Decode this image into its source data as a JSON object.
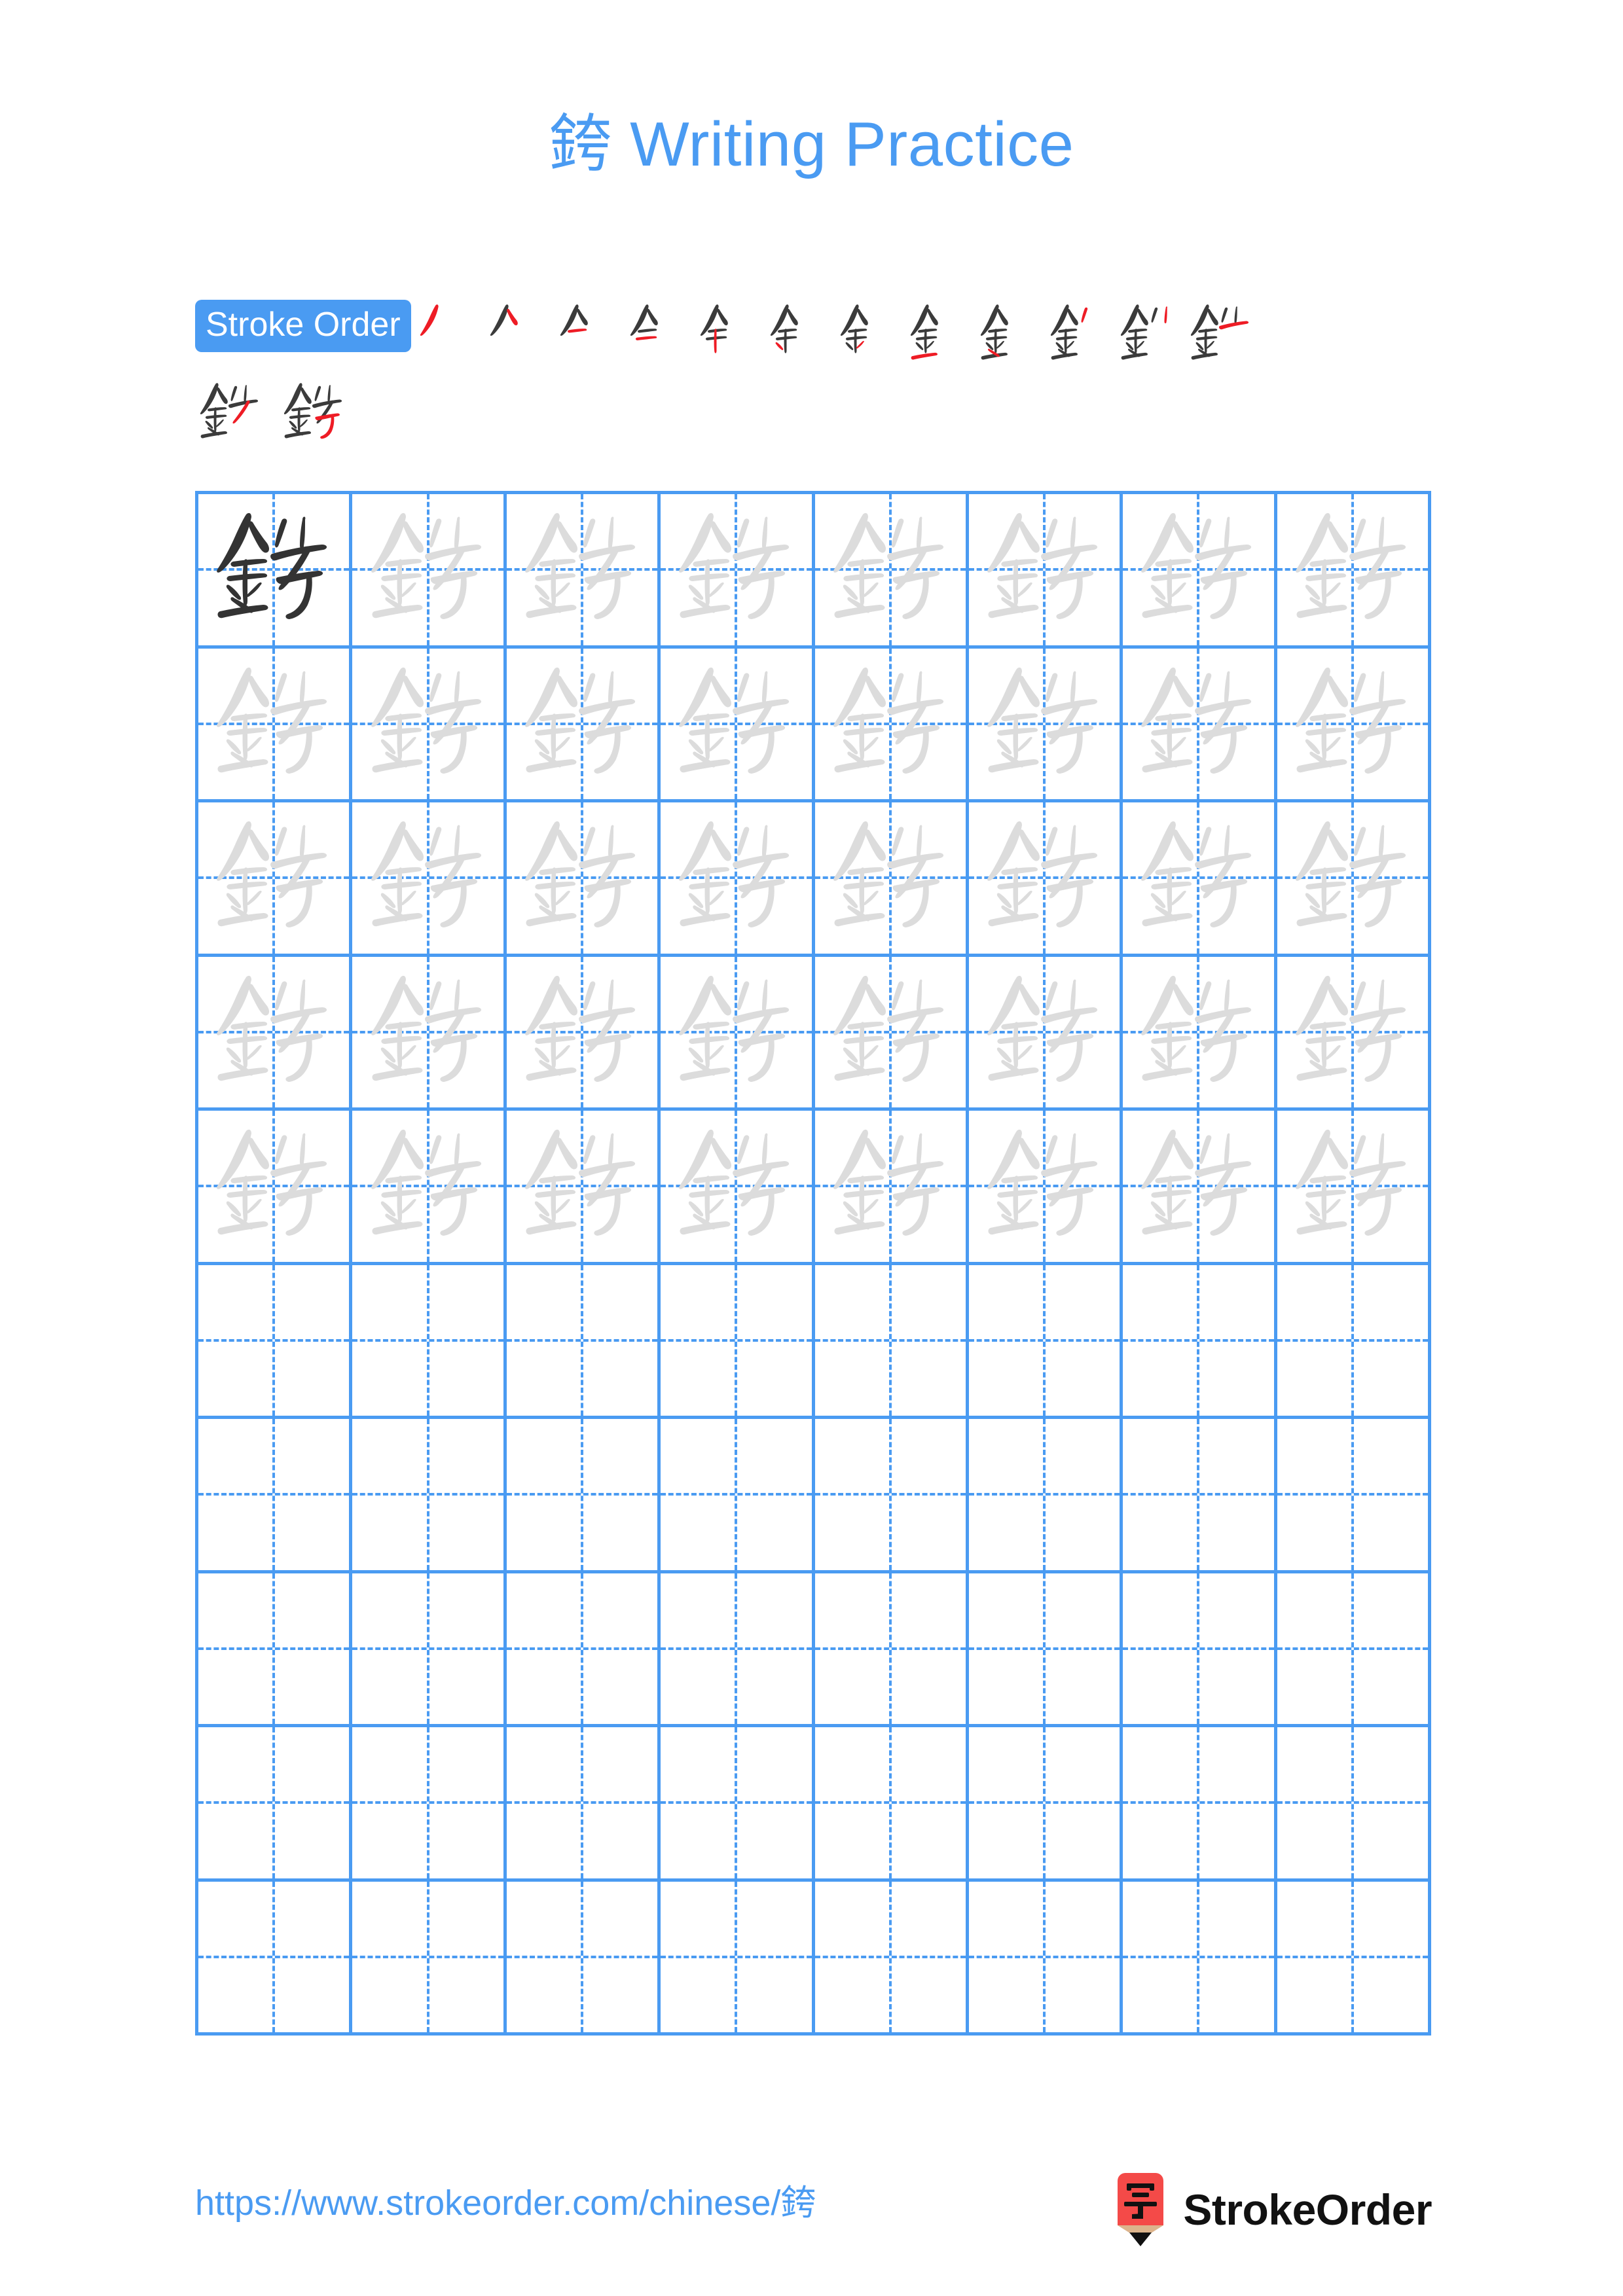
{
  "page": {
    "title_char": "銙",
    "title_suffix": " Writing Practice",
    "accent_blue": "#4a9bf2",
    "grid_line_blue": "#4a9bf2",
    "model_char_color": "#333333",
    "trace_char_color": "#dcdcdc",
    "new_stroke_color": "#ee1c25",
    "prev_stroke_color": "#3b3b3b",
    "background": "#ffffff"
  },
  "stroke_order": {
    "label": "Stroke Order",
    "character": "銙",
    "total_strokes": 14,
    "row1_count": 12,
    "row2_count": 2,
    "steps": [
      {
        "index": 1,
        "glyph": "丿"
      },
      {
        "index": 2,
        "glyph": "𠂉"
      },
      {
        "index": 3,
        "glyph": "亽"
      },
      {
        "index": 4,
        "glyph": "𠆢"
      },
      {
        "index": 5,
        "glyph": "全"
      },
      {
        "index": 6,
        "glyph": "余"
      },
      {
        "index": 7,
        "glyph": "𠂢"
      },
      {
        "index": 8,
        "glyph": "金"
      },
      {
        "index": 9,
        "glyph": "釒"
      },
      {
        "index": 10,
        "glyph": "釕"
      },
      {
        "index": 11,
        "glyph": "針"
      },
      {
        "index": 12,
        "glyph": "鈇"
      },
      {
        "index": 13,
        "glyph": "銈"
      },
      {
        "index": 14,
        "glyph": "銙"
      }
    ]
  },
  "practice_grid": {
    "columns": 8,
    "rows": 10,
    "character": "銙",
    "filled_rows": 5,
    "empty_rows": 5,
    "model_cell": {
      "row": 1,
      "col": 1
    },
    "guide_style": "dashed-crosshair",
    "row_states": [
      "model-then-trace",
      "trace",
      "trace",
      "trace",
      "trace",
      "empty",
      "empty",
      "empty",
      "empty",
      "empty"
    ]
  },
  "footer": {
    "url": "https://www.strokeorder.com/chinese/銙",
    "brand_name": "StrokeOrder",
    "logo_char": "字",
    "logo_body_color": "#f44a48",
    "logo_tip_color": "#dcb48c",
    "logo_point_color": "#111111"
  }
}
